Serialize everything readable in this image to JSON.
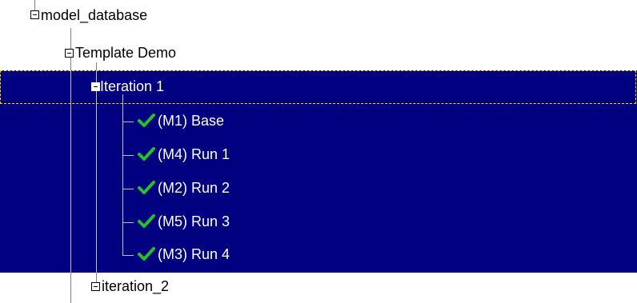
{
  "tree": {
    "root": {
      "label": "model_database",
      "expander": "collapse",
      "icon": "minus-box-icon"
    },
    "project": {
      "label": "Template Demo",
      "expander": "collapse",
      "icon": "minus-box-icon"
    },
    "iteration_1": {
      "label": "Iteration 1",
      "expander": "collapse",
      "icon": "minus-box-icon",
      "selected": true,
      "children": [
        {
          "label": "(M1) Base",
          "status_icon": "green-checkmark-icon"
        },
        {
          "label": "(M4) Run 1",
          "status_icon": "green-checkmark-icon"
        },
        {
          "label": "(M2) Run 2",
          "status_icon": "green-checkmark-icon"
        },
        {
          "label": "(M5) Run 3",
          "status_icon": "green-checkmark-icon"
        },
        {
          "label": "(M3) Run 4",
          "status_icon": "green-checkmark-icon"
        }
      ]
    },
    "iteration_2": {
      "label": "iteration_2",
      "expander": "collapse",
      "icon": "minus-box-icon"
    }
  },
  "colors": {
    "selection_background": "#000080",
    "selection_text": "#ffffff",
    "focus_border": "#ffd700",
    "check_green": "#22c22a",
    "connector_line": "#808080"
  }
}
